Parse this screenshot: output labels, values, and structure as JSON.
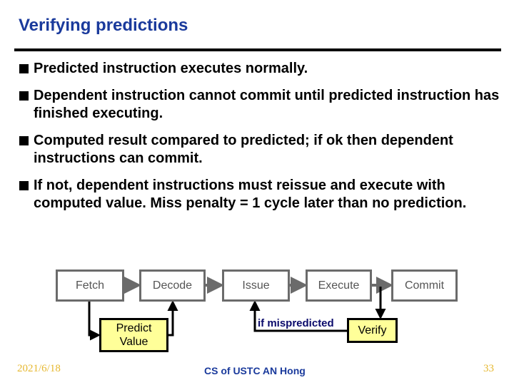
{
  "slide": {
    "title": "Verifying predictions",
    "bullets": [
      {
        "text": "Predicted instruction executes normally."
      },
      {
        "text": "Dependent instruction cannot commit until predicted instruction has finished executing."
      },
      {
        "text": "Computed result compared to predicted; if ok then dependent instructions can commit."
      },
      {
        "text": "If not, dependent instructions must reissue and execute with computed value.  Miss penalty = 1 cycle later than no prediction."
      }
    ]
  },
  "diagram": {
    "pipeline_stages": [
      "Fetch",
      "Decode",
      "Issue",
      "Execute",
      "Commit"
    ],
    "predict_box": "Predict Value",
    "predict_box_lines": [
      "Predict",
      "Value"
    ],
    "verify_box": "Verify",
    "mispredict_label": "if mispredicted",
    "colors": {
      "stage_border": "#6b6b6b",
      "highlight_fill": "#ffff99",
      "wire": "#000000",
      "label": "#0a0a6b"
    }
  },
  "footer": {
    "date": "2021/6/18",
    "author": "CS of USTC AN Hong",
    "page_number": "33"
  },
  "colors": {
    "title": "#1a3a9c",
    "footer_accent": "#e6b830"
  }
}
